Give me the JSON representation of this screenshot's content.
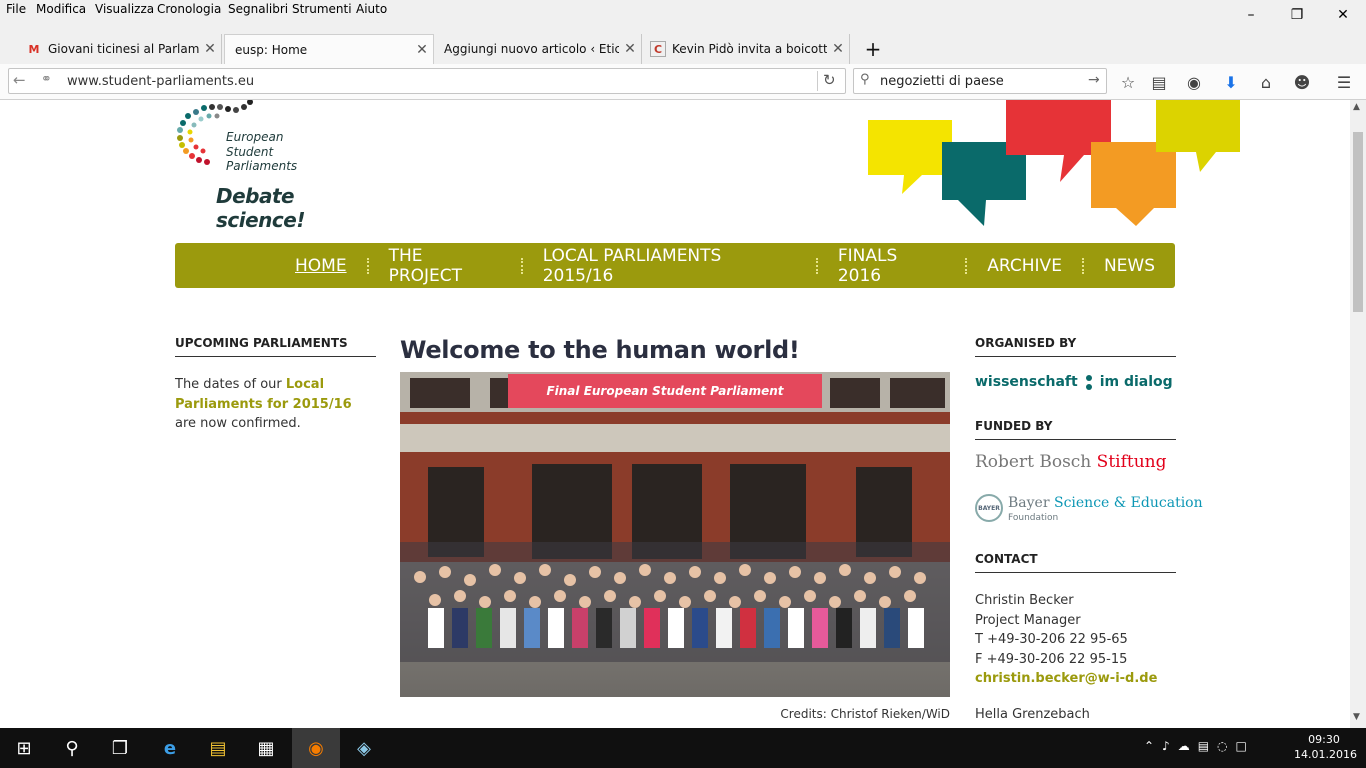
{
  "menubar": {
    "items": [
      "File",
      "Modifica",
      "Visualizza",
      "Cronologia",
      "Segnalibri",
      "Strumenti",
      "Aiuto"
    ]
  },
  "tabs": [
    {
      "label": "Giovani ticinesi al Parlame...",
      "icon": "gmail-icon"
    },
    {
      "label": "eusp: Home",
      "icon": "none"
    },
    {
      "label": "Aggiungi nuovo articolo ‹ Etici...",
      "icon": "none"
    },
    {
      "label": "Kevin Pidò invita a boicott...",
      "icon": "site-icon"
    }
  ],
  "navbar": {
    "url": "www.student-parliaments.eu",
    "search": "negozietti di paese"
  },
  "site": {
    "logo_line1": "European",
    "logo_line2": "Student",
    "logo_line3": "Parliaments",
    "tagline": "Debate science!",
    "nav": [
      "HOME",
      "THE PROJECT",
      "LOCAL PARLIAMENTS 2015/16",
      "FINALS 2016",
      "ARCHIVE",
      "NEWS"
    ],
    "left": {
      "heading": "UPCOMING PARLIAMENTS",
      "text_before": "The dates of our ",
      "link": "Local Parliaments for 2015/16",
      "text_after": " are now confirmed."
    },
    "main": {
      "title": "Welcome to the human world!",
      "banner": "Final European Student Parliament",
      "credits": "Credits: Christof Rieken/WiD"
    },
    "right": {
      "organised_heading": "ORGANISED BY",
      "wid_left": "wissenschaft",
      "wid_right": "im dialog",
      "funded_heading": "FUNDED BY",
      "bosch_gray": "Robert Bosch ",
      "bosch_red": "Stiftung",
      "bayer_badge": "BAYER",
      "bayer_name1": "Bayer ",
      "bayer_name2": "Science & Education",
      "bayer_sub": "Foundation",
      "contact_heading": "CONTACT",
      "contact_name": "Christin Becker",
      "contact_role": "Project Manager",
      "contact_t": "T +49-30-206 22 95-65",
      "contact_f": "F +49-30-206 22 95-15",
      "contact_email": "christin.becker@w-i-d.de",
      "contact_name2": "Hella Grenzebach"
    }
  },
  "taskbar": {
    "time": "09:30",
    "date": "14.01.2016"
  },
  "colors": {
    "olive": "#9b9a0d",
    "yellow": "#f4e400",
    "teal": "#0a6a6a",
    "red": "#e63337",
    "orange": "#f39b23",
    "yellow2": "#dcd300"
  }
}
